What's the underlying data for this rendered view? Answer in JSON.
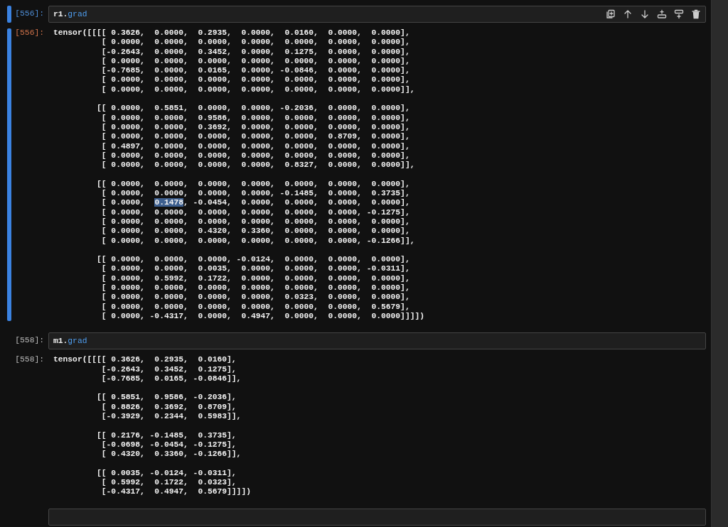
{
  "cells": [
    {
      "selected": true,
      "input_prompt": "[556]:",
      "code": [
        {
          "text": "r1.",
          "kind": "plain"
        },
        {
          "text": "grad",
          "kind": "attr"
        }
      ],
      "output_prompt": "[556]:",
      "output": [
        [
          "tensor([[[[ 0.3626,  0.0000,  0.2935,  0.0000,  0.0160,  0.0000,  0.0000],",
          "          [ 0.0000,  0.0000,  0.0000,  0.0000,  0.0000,  0.0000,  0.0000],",
          "          [-0.2643,  0.0000,  0.3452,  0.0000,  0.1275,  0.0000,  0.0000],",
          "          [ 0.0000,  0.0000,  0.0000,  0.0000,  0.0000,  0.0000,  0.0000],",
          "          [-0.7685,  0.0000,  0.0165,  0.0000, -0.0846,  0.0000,  0.0000],",
          "          [ 0.0000,  0.0000,  0.0000,  0.0000,  0.0000,  0.0000,  0.0000],",
          "          [ 0.0000,  0.0000,  0.0000,  0.0000,  0.0000,  0.0000,  0.0000]],"
        ],
        [
          "         [[ 0.0000,  0.5851,  0.0000,  0.0000, -0.2036,  0.0000,  0.0000],",
          "          [ 0.0000,  0.0000,  0.9586,  0.0000,  0.0000,  0.0000,  0.0000],",
          "          [ 0.0000,  0.0000,  0.3692,  0.0000,  0.0000,  0.0000,  0.0000],",
          "          [ 0.0000,  0.0000,  0.0000,  0.0000,  0.0000,  0.8709,  0.0000],",
          "          [ 0.4897,  0.0000,  0.0000,  0.0000,  0.0000,  0.0000,  0.0000],",
          "          [ 0.0000,  0.0000,  0.0000,  0.0000,  0.0000,  0.0000,  0.0000],",
          "          [ 0.0000,  0.0000,  0.0000,  0.0000,  0.8327,  0.0000,  0.0000]],"
        ],
        [
          "         [[ 0.0000,  0.0000,  0.0000,  0.0000,  0.0000,  0.0000,  0.0000],",
          "          [ 0.0000,  0.0000,  0.0000,  0.0000, -0.1485,  0.0000,  0.3735],",
          {
            "segments": [
              {
                "text": "          [ 0.0000,  ",
                "selected": false
              },
              {
                "text": "0.1478",
                "selected": true
              },
              {
                "text": ", -0.0454,  0.0000,  0.0000,  0.0000,  0.0000],",
                "selected": false
              }
            ]
          },
          "          [ 0.0000,  0.0000,  0.0000,  0.0000,  0.0000,  0.0000, -0.1275],",
          "          [ 0.0000,  0.0000,  0.0000,  0.0000,  0.0000,  0.0000,  0.0000],",
          "          [ 0.0000,  0.0000,  0.4320,  0.3360,  0.0000,  0.0000,  0.0000],",
          "          [ 0.0000,  0.0000,  0.0000,  0.0000,  0.0000,  0.0000, -0.1266]],"
        ],
        [
          "         [[ 0.0000,  0.0000,  0.0000, -0.0124,  0.0000,  0.0000,  0.0000],",
          "          [ 0.0000,  0.0000,  0.0035,  0.0000,  0.0000,  0.0000, -0.0311],",
          "          [ 0.0000,  0.5992,  0.1722,  0.0000,  0.0000,  0.0000,  0.0000],",
          "          [ 0.0000,  0.0000,  0.0000,  0.0000,  0.0000,  0.0000,  0.0000],",
          "          [ 0.0000,  0.0000,  0.0000,  0.0000,  0.0323,  0.0000,  0.0000],",
          "          [ 0.0000,  0.0000,  0.0000,  0.0000,  0.0000,  0.0000,  0.5679],",
          "          [ 0.0000, -0.4317,  0.0000,  0.4947,  0.0000,  0.0000,  0.0000]]]])"
        ]
      ]
    },
    {
      "selected": false,
      "input_prompt": "[558]:",
      "code": [
        {
          "text": "m1.",
          "kind": "plain"
        },
        {
          "text": "grad",
          "kind": "attr"
        }
      ],
      "output_prompt": "[558]:",
      "output": [
        [
          "tensor([[[[ 0.3626,  0.2935,  0.0160],",
          "          [-0.2643,  0.3452,  0.1275],",
          "          [-0.7685,  0.0165, -0.0846]],"
        ],
        [
          "         [[ 0.5851,  0.9586, -0.2036],",
          "          [ 0.8826,  0.3692,  0.8709],",
          "          [-0.3929,  0.2344,  0.5983]],"
        ],
        [
          "         [[ 0.2176, -0.1485,  0.3735],",
          "          [-0.0698, -0.0454, -0.1275],",
          "          [ 0.4320,  0.3360, -0.1266]],"
        ],
        [
          "         [[ 0.0035, -0.0124, -0.0311],",
          "          [ 0.5992,  0.1722,  0.0323],",
          "          [-0.4317,  0.4947,  0.5679]]]])"
        ]
      ]
    },
    {
      "selected": false
    }
  ]
}
